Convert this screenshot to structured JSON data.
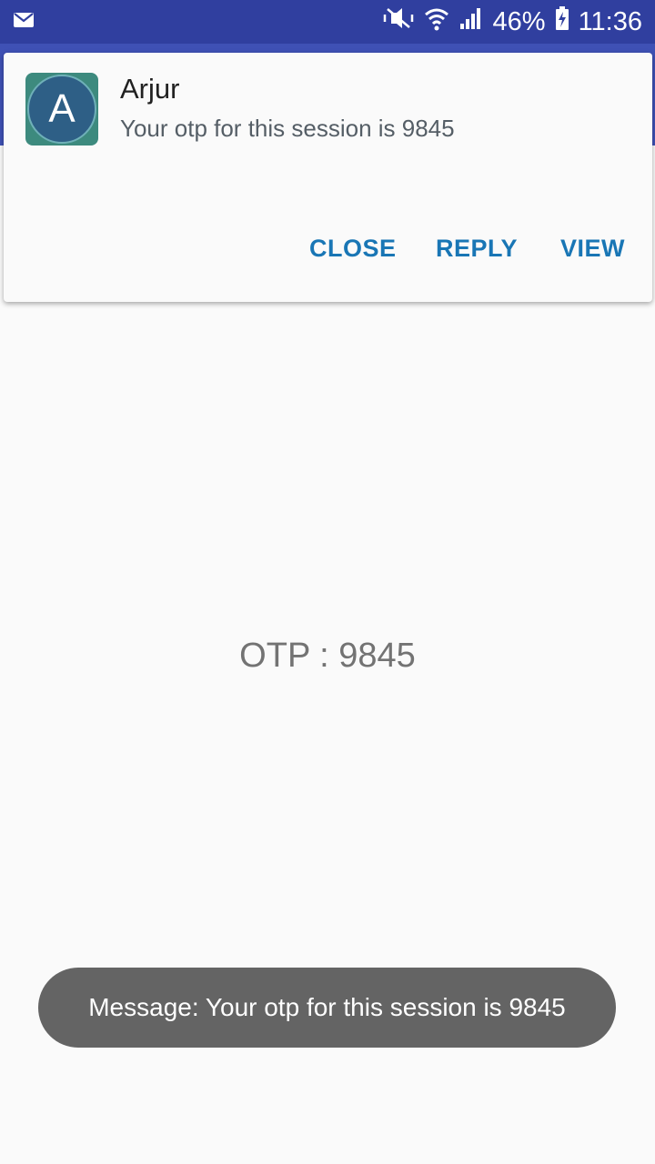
{
  "status_bar": {
    "battery_percent": "46%",
    "time": "11:36",
    "icons": {
      "left": "message-notification-icon",
      "mute": "mute-icon",
      "wifi": "wifi-icon",
      "signal": "signal-icon",
      "battery": "battery-charging-icon"
    },
    "color": "#303f9f"
  },
  "app_bar": {
    "color": "#3f51b5"
  },
  "notification": {
    "avatar_letter": "A",
    "title": "Arjur",
    "text": "Your otp for this session is 9845",
    "actions": {
      "close": "CLOSE",
      "reply": "REPLY",
      "view": "VIEW"
    },
    "action_color": "#1976b5"
  },
  "main": {
    "otp_label": "OTP : 9845"
  },
  "toast": {
    "text": "Message: Your otp for this session is 9845"
  }
}
